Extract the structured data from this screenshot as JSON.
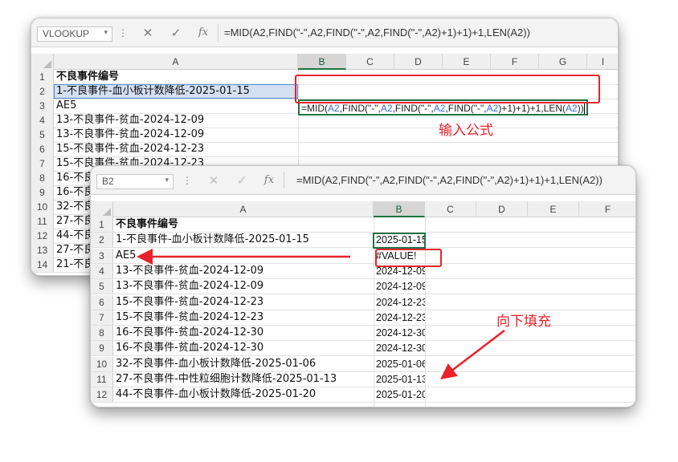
{
  "colors": {
    "accent_red": "#e8222a",
    "excel_green": "#217346",
    "ref_blue": "#3b6bd6"
  },
  "top_window": {
    "namebox": "VLOOKUP",
    "formula": "=MID(A2,FIND(\"-\",A2,FIND(\"-\",A2,FIND(\"-\",A2)+1)+1)+1,LEN(A2))",
    "columns": [
      "A",
      "B",
      "C",
      "D",
      "E",
      "F",
      "G",
      "I"
    ],
    "rows": [
      {
        "n": "1",
        "a": "不良事件编号"
      },
      {
        "n": "2",
        "a": "1-不良事件-血小板计数降低-2025-01-15"
      },
      {
        "n": "3",
        "a": "AE5"
      },
      {
        "n": "4",
        "a": "13-不良事件-贫血-2024-12-09"
      },
      {
        "n": "5",
        "a": "13-不良事件-贫血-2024-12-09"
      },
      {
        "n": "6",
        "a": "15-不良事件-贫血-2024-12-23"
      },
      {
        "n": "7",
        "a": "15-不良事件-贫血-2024-12-23"
      },
      {
        "n": "8",
        "a": "16-不良"
      },
      {
        "n": "9",
        "a": "16-不良"
      },
      {
        "n": "10",
        "a": "32-不良"
      },
      {
        "n": "11",
        "a": "27-不良"
      },
      {
        "n": "12",
        "a": "44-不良"
      },
      {
        "n": "13",
        "a": "27-不良"
      },
      {
        "n": "14",
        "a": "21-不良"
      }
    ],
    "editing_formula_parts": [
      {
        "t": "=MID(",
        "c": "fr"
      },
      {
        "t": "A2",
        "c": "fb"
      },
      {
        "t": ",FIND(\"-\",",
        "c": "fr"
      },
      {
        "t": "A2",
        "c": "fb"
      },
      {
        "t": ",FIND(\"-\",",
        "c": "fr"
      },
      {
        "t": "A2",
        "c": "fb"
      },
      {
        "t": ",FIND(\"-\",",
        "c": "fr"
      },
      {
        "t": "A2",
        "c": "fb"
      },
      {
        "t": ")+1)+1)+1,LEN(",
        "c": "fr"
      },
      {
        "t": "A2",
        "c": "fb"
      },
      {
        "t": "))",
        "c": "fr"
      }
    ],
    "annotation": "输入公式"
  },
  "bottom_window": {
    "namebox": "B2",
    "formula": "=MID(A2,FIND(\"-\",A2,FIND(\"-\",A2,FIND(\"-\",A2)+1)+1)+1,LEN(A2))",
    "columns": [
      "A",
      "B",
      "C",
      "D",
      "E",
      "F"
    ],
    "rows": [
      {
        "n": "1",
        "a": "不良事件编号",
        "b": ""
      },
      {
        "n": "2",
        "a": "1-不良事件-血小板计数降低-2025-01-15",
        "b": "2025-01-15"
      },
      {
        "n": "3",
        "a": "AE5",
        "b": "#VALUE!"
      },
      {
        "n": "4",
        "a": "13-不良事件-贫血-2024-12-09",
        "b": "2024-12-09"
      },
      {
        "n": "5",
        "a": "13-不良事件-贫血-2024-12-09",
        "b": "2024-12-09"
      },
      {
        "n": "6",
        "a": "15-不良事件-贫血-2024-12-23",
        "b": "2024-12-23"
      },
      {
        "n": "7",
        "a": "15-不良事件-贫血-2024-12-23",
        "b": "2024-12-23"
      },
      {
        "n": "8",
        "a": "16-不良事件-贫血-2024-12-30",
        "b": "2024-12-30"
      },
      {
        "n": "9",
        "a": "16-不良事件-贫血-2024-12-30",
        "b": "2024-12-30"
      },
      {
        "n": "10",
        "a": "32-不良事件-血小板计数降低-2025-01-06",
        "b": "2025-01-06"
      },
      {
        "n": "11",
        "a": "27-不良事件-中性粒细胞计数降低-2025-01-13",
        "b": "2025-01-13"
      },
      {
        "n": "12",
        "a": "44-不良事件-血小板计数降低-2025-01-20",
        "b": "2025-01-20"
      }
    ],
    "annotation": "向下填充"
  }
}
